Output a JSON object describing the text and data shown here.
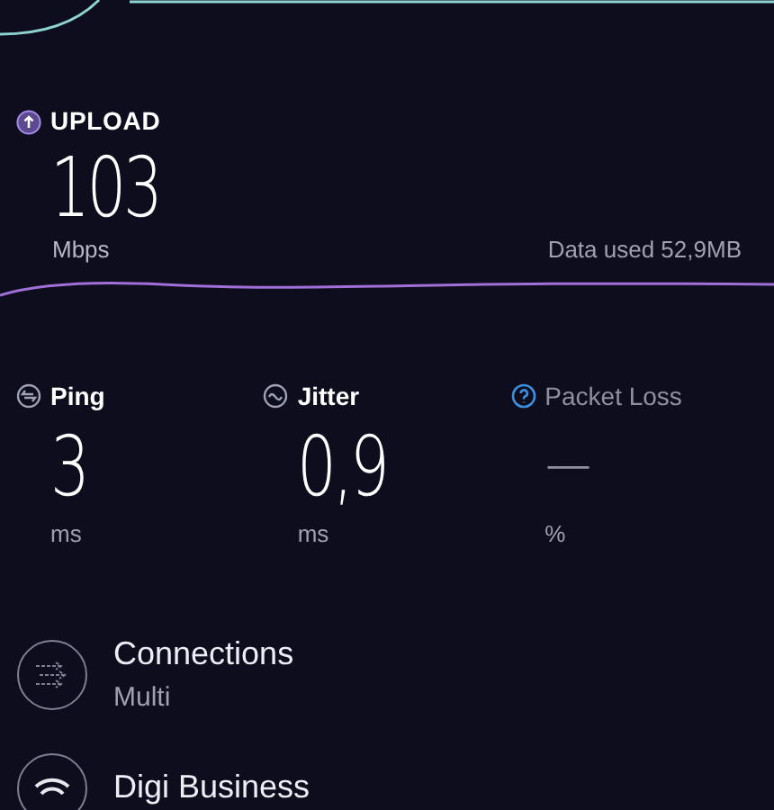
{
  "upload": {
    "label": "UPLOAD",
    "value": "103",
    "unit": "Mbps",
    "data_used": "Data used 52,9MB"
  },
  "stats": [
    {
      "kind": "ping",
      "label": "Ping",
      "value": "3",
      "unit": "ms",
      "disabled": false
    },
    {
      "kind": "jitter",
      "label": "Jitter",
      "value": "0,9",
      "unit": "ms",
      "disabled": false
    },
    {
      "kind": "loss",
      "label": "Packet Loss",
      "value": "—",
      "unit": "%",
      "disabled": true
    }
  ],
  "details": [
    {
      "kind": "connections",
      "title": "Connections",
      "subtitle": "Multi"
    },
    {
      "kind": "provider",
      "title": "Digi Business"
    }
  ]
}
